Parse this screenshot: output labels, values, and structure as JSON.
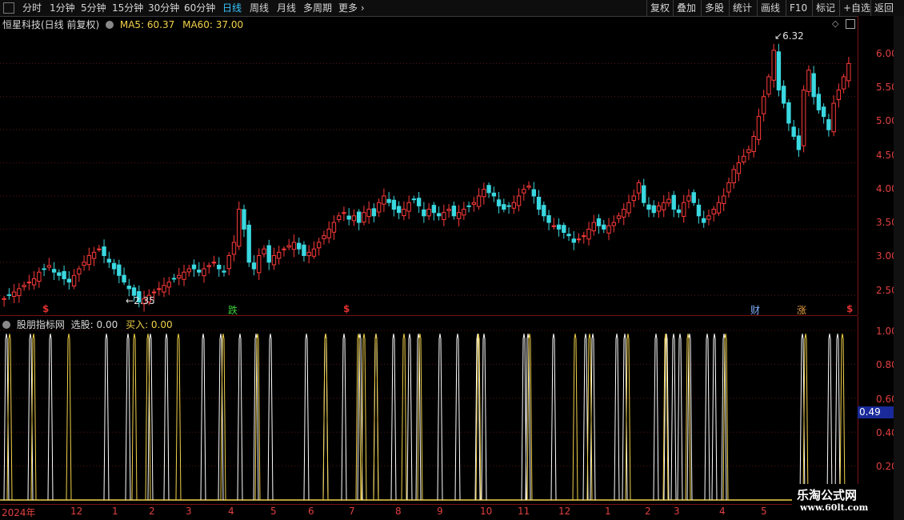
{
  "toolbar": {
    "periods": [
      "分时",
      "1分钟",
      "5分钟",
      "15分钟",
      "30分钟",
      "60分钟",
      "日线",
      "周线",
      "月线",
      "多周期",
      "更多"
    ],
    "active": "日线",
    "right": [
      "复权",
      "叠加",
      "多股",
      "统计",
      "画线",
      "F10",
      "标记",
      "+自选",
      "返回"
    ]
  },
  "chart_header": {
    "title": "恒星科技(日线 前复权)",
    "ma5": "MA5: 60.37",
    "ma60": "MA60: 37.00"
  },
  "price_panel": {
    "yticks": [
      "6.00",
      "5.50",
      "5.00",
      "4.50",
      "4.00",
      "3.50",
      "3.00",
      "2.50"
    ],
    "high_label": "6.32",
    "low_label": "2.35",
    "markers": [
      {
        "text": "$",
        "color": "#e03030"
      },
      {
        "text": "跌",
        "color": "#3ad13a"
      },
      {
        "text": "$",
        "color": "#e03030"
      },
      {
        "text": "财",
        "color": "#7fb0ff"
      },
      {
        "text": "涨",
        "color": "#e8a040"
      },
      {
        "text": "$",
        "color": "#e03030"
      }
    ]
  },
  "indicator": {
    "name": "股朋指标网",
    "select_label": "选股: 0.00",
    "buy_label": "买入: 0.00",
    "yticks": [
      "1.00",
      "0.80",
      "0.60",
      "0.40",
      "0.20"
    ],
    "current": "0.49"
  },
  "xaxis": [
    "2024年",
    "12",
    "1",
    "2",
    "3",
    "4",
    "5",
    "6",
    "7",
    "8",
    "9",
    "10",
    "11",
    "12",
    "1",
    "2",
    "3",
    "4",
    "5"
  ],
  "watermark": {
    "line1": "乐淘公式网",
    "line2": "www.60lt.com"
  },
  "chart_data": {
    "type": "candlestick",
    "ylim": [
      2.2,
      6.5
    ],
    "close": [
      2.45,
      2.5,
      2.55,
      2.6,
      2.65,
      2.7,
      2.75,
      2.85,
      2.9,
      2.95,
      2.85,
      2.8,
      2.75,
      2.7,
      2.8,
      2.9,
      3.0,
      3.1,
      3.15,
      3.2,
      3.1,
      3.0,
      2.9,
      2.8,
      2.7,
      2.6,
      2.5,
      2.4,
      2.45,
      2.5,
      2.55,
      2.6,
      2.65,
      2.7,
      2.75,
      2.8,
      2.85,
      2.9,
      2.9,
      2.85,
      2.9,
      2.95,
      3.0,
      2.9,
      2.85,
      3.1,
      3.3,
      3.8,
      3.5,
      3.0,
      2.9,
      3.1,
      3.2,
      3.0,
      3.1,
      3.15,
      3.2,
      3.25,
      3.3,
      3.2,
      3.1,
      3.15,
      3.2,
      3.3,
      3.4,
      3.5,
      3.6,
      3.7,
      3.75,
      3.65,
      3.7,
      3.6,
      3.75,
      3.8,
      3.7,
      3.9,
      4.0,
      3.9,
      3.8,
      3.75,
      3.8,
      3.9,
      3.95,
      3.85,
      3.7,
      3.8,
      3.75,
      3.7,
      3.75,
      3.8,
      3.7,
      3.75,
      3.8,
      3.85,
      3.9,
      4.0,
      4.1,
      4.05,
      4.0,
      3.85,
      3.8,
      3.85,
      3.9,
      4.0,
      4.1,
      4.15,
      4.0,
      3.8,
      3.7,
      3.6,
      3.55,
      3.5,
      3.45,
      3.4,
      3.3,
      3.35,
      3.4,
      3.5,
      3.6,
      3.55,
      3.5,
      3.55,
      3.6,
      3.7,
      3.8,
      3.9,
      4.0,
      4.2,
      3.9,
      3.8,
      3.75,
      3.85,
      3.9,
      3.95,
      3.8,
      3.75,
      3.9,
      4.0,
      3.9,
      3.7,
      3.6,
      3.7,
      3.8,
      3.9,
      4.0,
      4.2,
      4.4,
      4.5,
      4.6,
      4.7,
      4.9,
      5.2,
      5.5,
      5.8,
      6.2,
      5.6,
      5.4,
      5.1,
      4.9,
      4.7,
      5.6,
      5.9,
      5.5,
      5.3,
      5.2,
      5.0,
      5.4,
      5.6,
      5.8,
      6.0
    ]
  }
}
